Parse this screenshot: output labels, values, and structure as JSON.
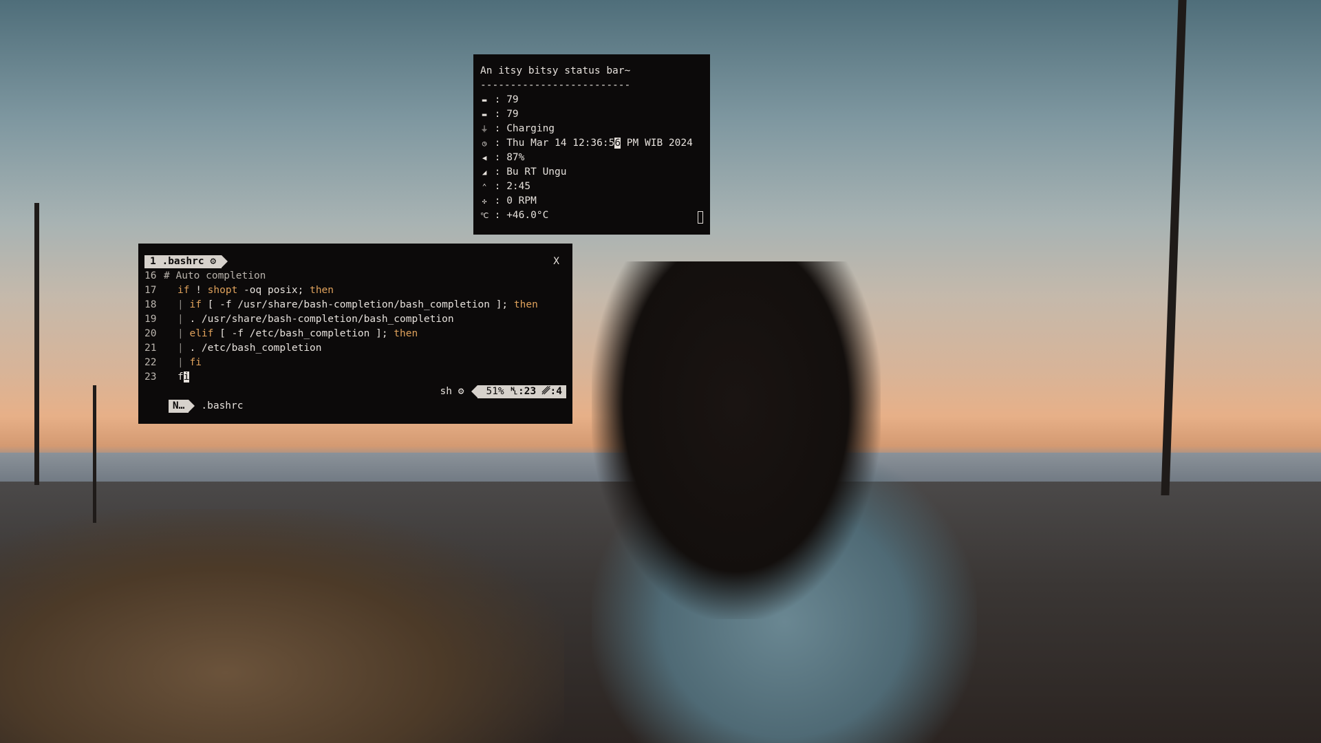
{
  "status_window": {
    "title": "An itsy bitsy status bar~",
    "divider": "-------------------------",
    "rows": [
      {
        "icon": "memory-icon",
        "glyph": "▬",
        "value": "79"
      },
      {
        "icon": "battery-icon",
        "glyph": "▬",
        "value": "79"
      },
      {
        "icon": "plug-icon",
        "glyph": "⏚",
        "value": "Charging"
      },
      {
        "icon": "clock-icon",
        "glyph": "◷",
        "value_before": "Thu Mar 14 12:36:5",
        "value_cursor": "6",
        "value_after": " PM WIB 2024"
      },
      {
        "icon": "volume-icon",
        "glyph": "◀",
        "value": "87%"
      },
      {
        "icon": "wifi-signal-icon",
        "glyph": "◢",
        "value": "Bu RT Ungu"
      },
      {
        "icon": "uptime-icon",
        "glyph": "⌃",
        "value": "2:45"
      },
      {
        "icon": "fan-icon",
        "glyph": "✣",
        "value": "0 RPM"
      },
      {
        "icon": "temperature-icon",
        "glyph": "℃",
        "value": "+46.0°C"
      }
    ],
    "separator": " : "
  },
  "vim_window": {
    "tab": {
      "number": "1",
      "name": ".bashrc",
      "gear": "⚙"
    },
    "close_label": "X",
    "lines": [
      {
        "n": "16",
        "text": "# Auto completion"
      },
      {
        "n": "17",
        "text": "if ! shopt -oq posix; then"
      },
      {
        "n": "18",
        "text": "| if [ -f /usr/share/bash-completion/bash_completion ]; then"
      },
      {
        "n": "19",
        "text": "| . /usr/share/bash-completion/bash_completion"
      },
      {
        "n": "20",
        "text": "| elif [ -f /etc/bash_completion ]; then"
      },
      {
        "n": "21",
        "text": "| . /etc/bash_completion"
      },
      {
        "n": "22",
        "text": "| fi"
      },
      {
        "n": "23",
        "text": "fi"
      }
    ],
    "statusline": {
      "mode": "N…",
      "filename": ".bashrc",
      "filetype": "sh ⚙",
      "percent": "51%",
      "line_col": "␤:23 ␥:4"
    }
  }
}
